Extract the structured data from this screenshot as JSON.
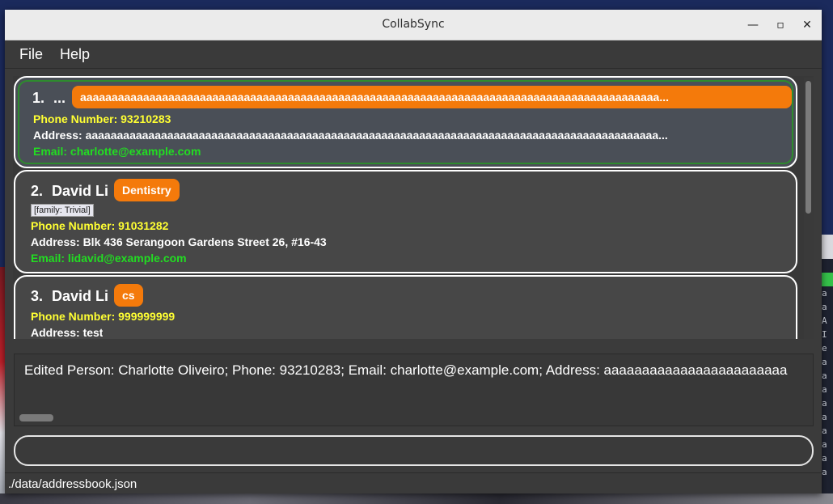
{
  "window": {
    "title": "CollabSync",
    "min_glyph": "—",
    "max_glyph": "▫",
    "close_glyph": "✕"
  },
  "menu": [
    "File",
    "Help"
  ],
  "persons": [
    {
      "index": "1.",
      "name": "...",
      "tag": "aaaaaaaaaaaaaaaaaaaaaaaaaaaaaaaaaaaaaaaaaaaaaaaaaaaaaaaaaaaaaaaaaaaaaaaaaaaaaaaaaaaaaaaaaaaa...",
      "relation": "",
      "phone": "Phone Number: 93210283",
      "address": "Address: aaaaaaaaaaaaaaaaaaaaaaaaaaaaaaaaaaaaaaaaaaaaaaaaaaaaaaaaaaaaaaaaaaaaaaaaaaaaaaaaaaaaaaaaaaa...",
      "email": "Email: charlotte@example.com"
    },
    {
      "index": "2.",
      "name": "David Li",
      "tag": "Dentistry",
      "relation": "[family: Trivial]",
      "phone": "Phone Number: 91031282",
      "address": "Address: Blk 436 Serangoon Gardens Street 26, #16-43",
      "email": "Email: lidavid@example.com"
    },
    {
      "index": "3.",
      "name": "David Li",
      "tag": "cs",
      "relation": "",
      "phone": "Phone Number: 999999999",
      "address": "Address: test",
      "email": ""
    }
  ],
  "result": "Edited Person: Charlotte Oliveiro; Phone: 93210283; Email: charlotte@example.com; Address: aaaaaaaaaaaaaaaaaaaaaaaa",
  "command": {
    "value": ""
  },
  "status": "./data/addressbook.json"
}
